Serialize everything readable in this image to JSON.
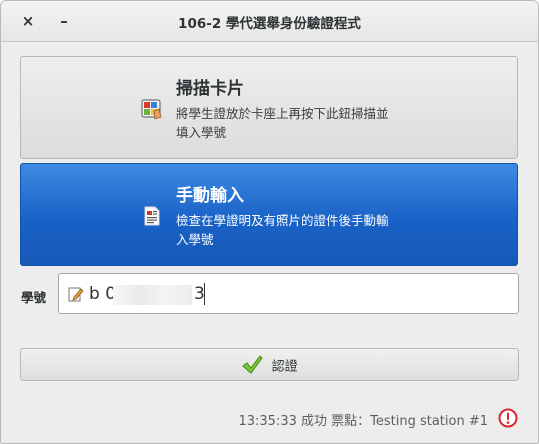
{
  "window": {
    "title": "106-2 學代選舉身份驗證程式",
    "close_glyph": "×",
    "minimize_glyph": "–"
  },
  "scan_button": {
    "title": "掃描卡片",
    "desc_line1": "將學生證放於卡座上再按下此鈕掃描並",
    "desc_line2": "填入學號",
    "icon": "card-reader-icon"
  },
  "manual_button": {
    "title": "手動輸入",
    "desc_line1": "檢查在學證明及有照片的證件後手動輸",
    "desc_line2": "入學號",
    "icon": "document-icon"
  },
  "student_id": {
    "label": "學號",
    "value_prefix": "b 0",
    "value_suffix": "3",
    "icon": "edit-icon"
  },
  "confirm": {
    "label": "認證",
    "icon": "check-icon"
  },
  "status": {
    "text": "13:35:33 成功 票點：Testing station #1",
    "icon": "warning-icon"
  },
  "colors": {
    "accent": "#1a62c7",
    "warning": "#d9262c",
    "check": "#6fbf2a"
  }
}
